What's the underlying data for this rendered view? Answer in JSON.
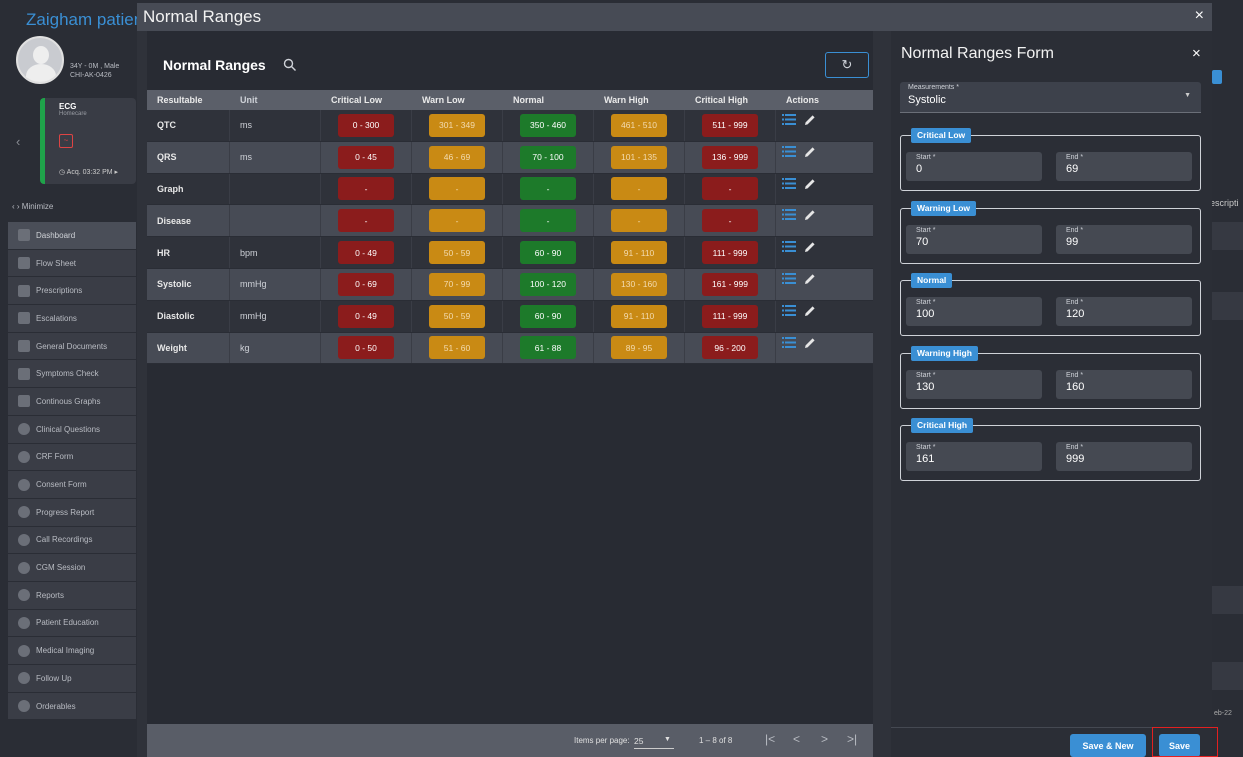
{
  "background": {
    "patient_name": "Zaigham patient",
    "patient_meta_line1": "34Y - 0M , Male",
    "patient_meta_line2": "CHI-AK-0426",
    "ecg_title": "ECG",
    "ecg_subtitle": "Homecare",
    "ecg_time": "Acq. 03:32 PM",
    "minimize_label": "Minimize",
    "right_partial_text": "escripti",
    "right_date_text": "eb-22",
    "nav_items": [
      {
        "label": "Dashboard",
        "icon": "dashboard-icon",
        "active": true
      },
      {
        "label": "Flow Sheet",
        "icon": "flow-sheet-icon"
      },
      {
        "label": "Prescriptions",
        "icon": "prescriptions-icon"
      },
      {
        "label": "Escalations",
        "icon": "escalations-icon"
      },
      {
        "label": "General Documents",
        "icon": "documents-icon"
      },
      {
        "label": "Symptoms Check",
        "icon": "symptoms-icon"
      },
      {
        "label": "Continous Graphs",
        "icon": "graphs-icon"
      },
      {
        "label": "Clinical Questions",
        "icon": "questions-icon"
      },
      {
        "label": "CRF Form",
        "icon": "crf-icon"
      },
      {
        "label": "Consent Form",
        "icon": "consent-icon"
      },
      {
        "label": "Progress Report",
        "icon": "progress-icon"
      },
      {
        "label": "Call Recordings",
        "icon": "recordings-icon"
      },
      {
        "label": "CGM Session",
        "icon": "cgm-icon"
      },
      {
        "label": "Reports",
        "icon": "reports-icon"
      },
      {
        "label": "Patient Education",
        "icon": "education-icon"
      },
      {
        "label": "Medical Imaging",
        "icon": "imaging-icon"
      },
      {
        "label": "Follow Up",
        "icon": "follow-up-icon"
      },
      {
        "label": "Orderables",
        "icon": "orderables-icon"
      }
    ]
  },
  "modal": {
    "title": "Normal Ranges",
    "close_icon": "×"
  },
  "list": {
    "title": "Normal Ranges",
    "refresh_icon": "↻",
    "columns": [
      "Resultable",
      "Unit",
      "Critical Low",
      "Warn Low",
      "Normal",
      "Warn High",
      "Critical High",
      "Actions"
    ],
    "rows": [
      {
        "resultable": "QTC",
        "unit": "ms",
        "critical_low": "0 - 300",
        "warn_low": "301 - 349",
        "normal": "350 - 460",
        "warn_high": "461 - 510",
        "critical_high": "511 - 999"
      },
      {
        "resultable": "QRS",
        "unit": "ms",
        "critical_low": "0 - 45",
        "warn_low": "46 - 69",
        "normal": "70 - 100",
        "warn_high": "101 - 135",
        "critical_high": "136 - 999"
      },
      {
        "resultable": "Graph",
        "unit": "",
        "critical_low": "-",
        "warn_low": "-",
        "normal": "-",
        "warn_high": "-",
        "critical_high": "-"
      },
      {
        "resultable": "Disease",
        "unit": "",
        "critical_low": "-",
        "warn_low": "-",
        "normal": "-",
        "warn_high": "-",
        "critical_high": "-"
      },
      {
        "resultable": "HR",
        "unit": "bpm",
        "critical_low": "0 - 49",
        "warn_low": "50 - 59",
        "normal": "60 - 90",
        "warn_high": "91 - 110",
        "critical_high": "111 - 999"
      },
      {
        "resultable": "Systolic",
        "unit": "mmHg",
        "critical_low": "0 - 69",
        "warn_low": "70 - 99",
        "normal": "100 - 120",
        "warn_high": "130 - 160",
        "critical_high": "161 - 999"
      },
      {
        "resultable": "Diastolic",
        "unit": "mmHg",
        "critical_low": "0 - 49",
        "warn_low": "50 - 59",
        "normal": "60 - 90",
        "warn_high": "91 - 110",
        "critical_high": "111 - 999"
      },
      {
        "resultable": "Weight",
        "unit": "kg",
        "critical_low": "0 - 50",
        "warn_low": "51 - 60",
        "normal": "61 - 88",
        "warn_high": "89 - 95",
        "critical_high": "96 - 200"
      }
    ],
    "paginator": {
      "items_per_page_label": "Items per page:",
      "items_per_page": "25",
      "range_label": "1 – 8 of 8",
      "first": "|<",
      "prev": "<",
      "next": ">",
      "last": ">|"
    }
  },
  "form": {
    "title": "Normal Ranges Form",
    "close_icon": "×",
    "measurement_label": "Measurements *",
    "measurement_value": "Systolic",
    "sections": [
      {
        "tag": "Critical Low",
        "start_label": "Start *",
        "start": "0",
        "end_label": "End *",
        "end": "69"
      },
      {
        "tag": "Warning Low",
        "start_label": "Start *",
        "start": "70",
        "end_label": "End *",
        "end": "99"
      },
      {
        "tag": "Normal",
        "start_label": "Start *",
        "start": "100",
        "end_label": "End *",
        "end": "120"
      },
      {
        "tag": "Warning High",
        "start_label": "Start *",
        "start": "130",
        "end_label": "End *",
        "end": "160"
      },
      {
        "tag": "Critical High",
        "start_label": "Start *",
        "start": "161",
        "end_label": "End *",
        "end": "999"
      }
    ],
    "save_new_label": "Save & New",
    "save_label": "Save"
  },
  "colors": {
    "accent": "#3a8fd4",
    "critical": "#8b1c1c",
    "warning": "#c98a14",
    "normal": "#1d7a2a",
    "highlight": "#e32020"
  }
}
